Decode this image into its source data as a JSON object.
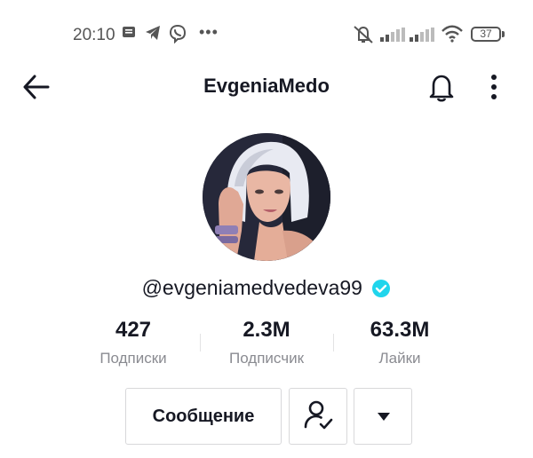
{
  "status_bar": {
    "time": "20:10",
    "battery": "37",
    "icons": [
      "notification-icon",
      "telegram-icon",
      "viber-icon",
      "more-dots-icon",
      "mute-icon",
      "signal-icon",
      "signal-icon",
      "wifi-icon",
      "battery-icon"
    ]
  },
  "header": {
    "title": "EvgeniaMedo",
    "icons": [
      "back-arrow-icon",
      "bell-icon",
      "more-vertical-icon"
    ]
  },
  "profile": {
    "handle": "@evgeniamedvedeva99",
    "verified": true
  },
  "stats": [
    {
      "value": "427",
      "label": "Подписки"
    },
    {
      "value": "2.3M",
      "label": "Подписчик"
    },
    {
      "value": "63.3M",
      "label": "Лайки"
    }
  ],
  "actions": {
    "message_label": "Сообщение",
    "follow_icon": "following-check-icon",
    "dropdown_icon": "caret-down-icon"
  },
  "colors": {
    "text": "#161823",
    "secondary_text": "#8a8b91",
    "verified": "#20d5ec",
    "border": "#d8d8da"
  }
}
